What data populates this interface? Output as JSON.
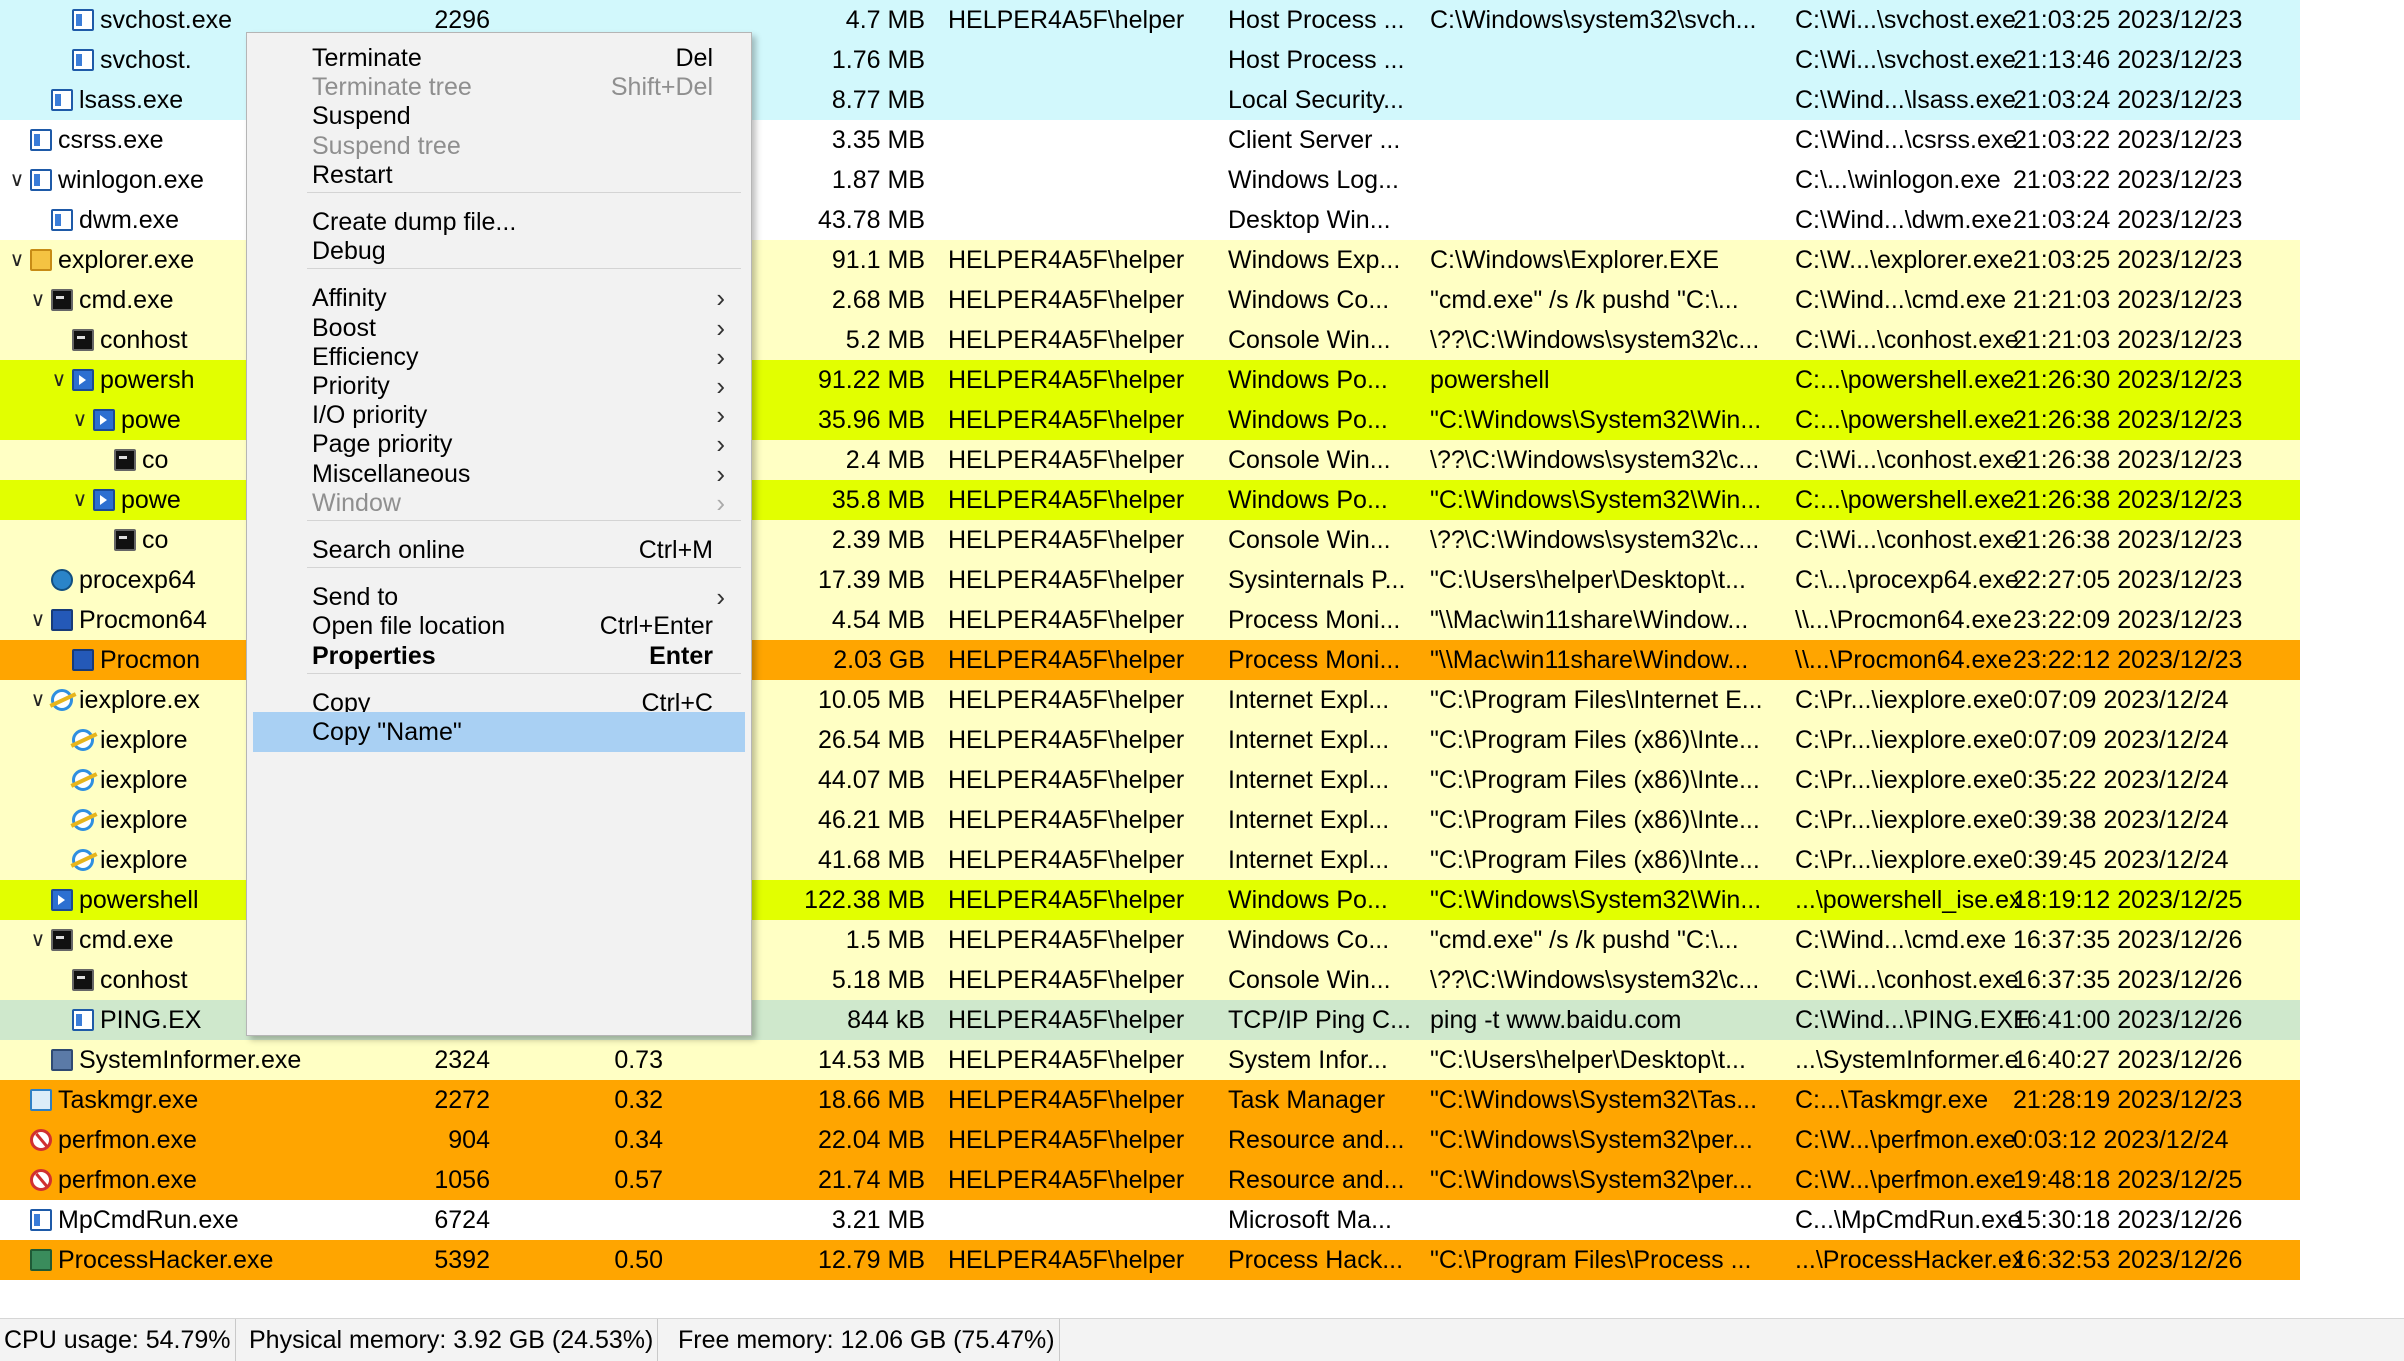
{
  "table": {
    "rows": [
      {
        "name": "svchost.exe",
        "pid": "2296",
        "cpu": "",
        "mem": "4.7 MB",
        "user": "HELPER4A5F\\helper",
        "desc": "Host Process ...",
        "cmd": "C:\\Windows\\system32\\svch...",
        "path": "C:\\Wi...\\svchost.exe",
        "time": "21:03:25 2023/12/23",
        "bg": "#d2f8fc",
        "depth": 3,
        "twisty": "",
        "icon": "service-icon"
      },
      {
        "name": "svchost.",
        "pid": "",
        "cpu": "",
        "mem": "1.76 MB",
        "user": "",
        "desc": "Host Process ...",
        "cmd": "",
        "path": "C:\\Wi...\\svchost.exe",
        "time": "21:13:46 2023/12/23",
        "bg": "#d2f8fc",
        "depth": 3,
        "twisty": "",
        "icon": "service-icon"
      },
      {
        "name": "lsass.exe",
        "pid": "",
        "cpu": "",
        "mem": "8.77 MB",
        "user": "",
        "desc": "Local Security...",
        "cmd": "",
        "path": "C:\\Wind...\\lsass.exe",
        "time": "21:03:24 2023/12/23",
        "bg": "#d2f8fc",
        "depth": 2,
        "twisty": "",
        "icon": "service-icon"
      },
      {
        "name": "csrss.exe",
        "pid": "",
        "cpu": "",
        "mem": "3.35 MB",
        "user": "",
        "desc": "Client Server ...",
        "cmd": "",
        "path": "C:\\Wind...\\csrss.exe",
        "time": "21:03:22 2023/12/23",
        "bg": "#ffffff",
        "depth": 1,
        "twisty": "",
        "icon": "window-icon"
      },
      {
        "name": "winlogon.exe",
        "pid": "",
        "cpu": "",
        "mem": "1.87 MB",
        "user": "",
        "desc": "Windows Log...",
        "cmd": "",
        "path": "C:\\...\\winlogon.exe",
        "time": "21:03:22 2023/12/23",
        "bg": "#ffffff",
        "depth": 1,
        "twisty": "v",
        "icon": "window-icon"
      },
      {
        "name": "dwm.exe",
        "pid": "",
        "cpu": "",
        "mem": "43.78 MB",
        "user": "",
        "desc": "Desktop Win...",
        "cmd": "",
        "path": "C:\\Wind...\\dwm.exe",
        "time": "21:03:24 2023/12/23",
        "bg": "#ffffff",
        "depth": 2,
        "twisty": "",
        "icon": "window-icon"
      },
      {
        "name": "explorer.exe",
        "pid": "",
        "cpu": "",
        "mem": "91.1 MB",
        "user": "HELPER4A5F\\helper",
        "desc": "Windows Exp...",
        "cmd": "C:\\Windows\\Explorer.EXE",
        "path": "C:\\W...\\explorer.exe",
        "time": "21:03:25 2023/12/23",
        "bg": "#ffffc4",
        "depth": 1,
        "twisty": "v",
        "icon": "explorer-icon"
      },
      {
        "name": "cmd.exe",
        "pid": "",
        "cpu": "",
        "mem": "2.68 MB",
        "user": "HELPER4A5F\\helper",
        "desc": "Windows Co...",
        "cmd": "\"cmd.exe\" /s /k pushd \"C:\\...",
        "path": "C:\\Wind...\\cmd.exe",
        "time": "21:21:03 2023/12/23",
        "bg": "#ffffc4",
        "depth": 2,
        "twisty": "v",
        "icon": "console-icon"
      },
      {
        "name": "conhost",
        "pid": "",
        "cpu": "",
        "mem": "5.2 MB",
        "user": "HELPER4A5F\\helper",
        "desc": "Console Win...",
        "cmd": "\\??\\C:\\Windows\\system32\\c...",
        "path": "C:\\Wi...\\conhost.exe",
        "time": "21:21:03 2023/12/23",
        "bg": "#ffffc4",
        "depth": 3,
        "twisty": "",
        "icon": "console-icon"
      },
      {
        "name": "powersh",
        "pid": "",
        "cpu": "",
        "mem": "91.22 MB",
        "user": "HELPER4A5F\\helper",
        "desc": "Windows Po...",
        "cmd": "powershell",
        "path": "C:...\\powershell.exe",
        "time": "21:26:30 2023/12/23",
        "bg": "#e2ff00",
        "depth": 3,
        "twisty": "v",
        "icon": "powershell-icon"
      },
      {
        "name": "powe",
        "pid": "",
        "cpu": "",
        "mem": "35.96 MB",
        "user": "HELPER4A5F\\helper",
        "desc": "Windows Po...",
        "cmd": "\"C:\\Windows\\System32\\Win...",
        "path": "C:...\\powershell.exe",
        "time": "21:26:38 2023/12/23",
        "bg": "#e2ff00",
        "depth": 4,
        "twisty": "v",
        "icon": "powershell-icon"
      },
      {
        "name": "co",
        "pid": "",
        "cpu": "",
        "mem": "2.4 MB",
        "user": "HELPER4A5F\\helper",
        "desc": "Console Win...",
        "cmd": "\\??\\C:\\Windows\\system32\\c...",
        "path": "C:\\Wi...\\conhost.exe",
        "time": "21:26:38 2023/12/23",
        "bg": "#ffffc4",
        "depth": 5,
        "twisty": "",
        "icon": "console-icon"
      },
      {
        "name": "powe",
        "pid": "",
        "cpu": "",
        "mem": "35.8 MB",
        "user": "HELPER4A5F\\helper",
        "desc": "Windows Po...",
        "cmd": "\"C:\\Windows\\System32\\Win...",
        "path": "C:...\\powershell.exe",
        "time": "21:26:38 2023/12/23",
        "bg": "#e2ff00",
        "depth": 4,
        "twisty": "v",
        "icon": "powershell-icon"
      },
      {
        "name": "co",
        "pid": "",
        "cpu": "",
        "mem": "2.39 MB",
        "user": "HELPER4A5F\\helper",
        "desc": "Console Win...",
        "cmd": "\\??\\C:\\Windows\\system32\\c...",
        "path": "C:\\Wi...\\conhost.exe",
        "time": "21:26:38 2023/12/23",
        "bg": "#ffffc4",
        "depth": 5,
        "twisty": "",
        "icon": "console-icon"
      },
      {
        "name": "procexp64",
        "pid": "",
        "cpu": "",
        "mem": "17.39 MB",
        "user": "HELPER4A5F\\helper",
        "desc": "Sysinternals P...",
        "cmd": "\"C:\\Users\\helper\\Desktop\\t...",
        "path": "C:\\...\\procexp64.exe",
        "time": "22:27:05 2023/12/23",
        "bg": "#ffffc4",
        "depth": 2,
        "twisty": "",
        "icon": "process-explorer-icon"
      },
      {
        "name": "Procmon64",
        "pid": "",
        "cpu": "",
        "mem": "4.54 MB",
        "user": "HELPER4A5F\\helper",
        "desc": "Process Moni...",
        "cmd": "\"\\\\Mac\\win11share\\Window...",
        "path": "\\\\...\\Procmon64.exe",
        "time": "23:22:09 2023/12/23",
        "bg": "#ffffc4",
        "depth": 2,
        "twisty": "v",
        "icon": "process-monitor-icon"
      },
      {
        "name": "Procmon",
        "pid": "",
        "cpu": "",
        "mem": "2.03 GB",
        "user": "HELPER4A5F\\helper",
        "desc": "Process Moni...",
        "cmd": "\"\\\\Mac\\win11share\\Window...",
        "path": "\\\\...\\Procmon64.exe",
        "time": "23:22:12 2023/12/23",
        "bg": "#ffa500",
        "depth": 3,
        "twisty": "",
        "icon": "process-monitor-icon"
      },
      {
        "name": "iexplore.ex",
        "pid": "",
        "cpu": "",
        "mem": "10.05 MB",
        "user": "HELPER4A5F\\helper",
        "desc": "Internet Expl...",
        "cmd": "\"C:\\Program Files\\Internet E...",
        "path": "C:\\Pr...\\iexplore.exe",
        "time": "0:07:09 2023/12/24",
        "bg": "#ffffc4",
        "depth": 2,
        "twisty": "v",
        "icon": "internet-explorer-icon"
      },
      {
        "name": "iexplore",
        "pid": "",
        "cpu": "",
        "mem": "26.54 MB",
        "user": "HELPER4A5F\\helper",
        "desc": "Internet Expl...",
        "cmd": "\"C:\\Program Files (x86)\\Inte...",
        "path": "C:\\Pr...\\iexplore.exe",
        "time": "0:07:09 2023/12/24",
        "bg": "#ffffc4",
        "depth": 3,
        "twisty": "",
        "icon": "internet-explorer-icon"
      },
      {
        "name": "iexplore",
        "pid": "",
        "cpu": "",
        "mem": "44.07 MB",
        "user": "HELPER4A5F\\helper",
        "desc": "Internet Expl...",
        "cmd": "\"C:\\Program Files (x86)\\Inte...",
        "path": "C:\\Pr...\\iexplore.exe",
        "time": "0:35:22 2023/12/24",
        "bg": "#ffffc4",
        "depth": 3,
        "twisty": "",
        "icon": "internet-explorer-icon"
      },
      {
        "name": "iexplore",
        "pid": "",
        "cpu": "",
        "mem": "46.21 MB",
        "user": "HELPER4A5F\\helper",
        "desc": "Internet Expl...",
        "cmd": "\"C:\\Program Files (x86)\\Inte...",
        "path": "C:\\Pr...\\iexplore.exe",
        "time": "0:39:38 2023/12/24",
        "bg": "#ffffc4",
        "depth": 3,
        "twisty": "",
        "icon": "internet-explorer-icon"
      },
      {
        "name": "iexplore",
        "pid": "",
        "cpu": "",
        "mem": "41.68 MB",
        "user": "HELPER4A5F\\helper",
        "desc": "Internet Expl...",
        "cmd": "\"C:\\Program Files (x86)\\Inte...",
        "path": "C:\\Pr...\\iexplore.exe",
        "time": "0:39:45 2023/12/24",
        "bg": "#ffffc4",
        "depth": 3,
        "twisty": "",
        "icon": "internet-explorer-icon"
      },
      {
        "name": "powershell",
        "pid": "",
        "cpu": "",
        "mem": "122.38 MB",
        "user": "HELPER4A5F\\helper",
        "desc": "Windows Po...",
        "cmd": "\"C:\\Windows\\System32\\Win...",
        "path": "...\\powershell_ise.ex",
        "time": "18:19:12 2023/12/25",
        "bg": "#e2ff00",
        "depth": 2,
        "twisty": "",
        "icon": "powershell-ise-icon"
      },
      {
        "name": "cmd.exe",
        "pid": "",
        "cpu": "",
        "mem": "1.5 MB",
        "user": "HELPER4A5F\\helper",
        "desc": "Windows Co...",
        "cmd": "\"cmd.exe\" /s /k pushd \"C:\\...",
        "path": "C:\\Wind...\\cmd.exe",
        "time": "16:37:35 2023/12/26",
        "bg": "#ffffc4",
        "depth": 2,
        "twisty": "v",
        "icon": "console-icon"
      },
      {
        "name": "conhost",
        "pid": "",
        "cpu": "",
        "mem": "5.18 MB",
        "user": "HELPER4A5F\\helper",
        "desc": "Console Win...",
        "cmd": "\\??\\C:\\Windows\\system32\\c...",
        "path": "C:\\Wi...\\conhost.exe",
        "time": "16:37:35 2023/12/26",
        "bg": "#ffffc4",
        "depth": 3,
        "twisty": "",
        "icon": "console-icon"
      },
      {
        "name": "PING.EX",
        "pid": "",
        "cpu": "",
        "mem": "844 kB",
        "user": "HELPER4A5F\\helper",
        "desc": "TCP/IP Ping C...",
        "cmd": "ping  -t www.baidu.com",
        "path": "C:\\Wind...\\PING.EXE",
        "time": "16:41:00 2023/12/26",
        "bg": "#cfe8cc",
        "depth": 3,
        "twisty": "",
        "icon": "window-icon"
      },
      {
        "name": "SystemInformer.exe",
        "pid": "2324",
        "cpu": "0.73",
        "mem": "14.53 MB",
        "user": "HELPER4A5F\\helper",
        "desc": "System Infor...",
        "cmd": "\"C:\\Users\\helper\\Desktop\\t...",
        "path": "...\\SystemInformer.e",
        "time": "16:40:27 2023/12/26",
        "bg": "#ffffc4",
        "depth": 2,
        "twisty": "",
        "icon": "system-informer-icon"
      },
      {
        "name": "Taskmgr.exe",
        "pid": "2272",
        "cpu": "0.32",
        "mem": "18.66 MB",
        "user": "HELPER4A5F\\helper",
        "desc": "Task Manager",
        "cmd": "\"C:\\Windows\\System32\\Tas...",
        "path": "C:...\\Taskmgr.exe",
        "time": "21:28:19 2023/12/23",
        "bg": "#ffa500",
        "depth": 1,
        "twisty": "",
        "icon": "task-manager-icon"
      },
      {
        "name": "perfmon.exe",
        "pid": "904",
        "cpu": "0.34",
        "mem": "22.04 MB",
        "user": "HELPER4A5F\\helper",
        "desc": "Resource and...",
        "cmd": "\"C:\\Windows\\System32\\per...",
        "path": "C:\\W...\\perfmon.exe",
        "time": "0:03:12 2023/12/24",
        "bg": "#ffa500",
        "depth": 1,
        "twisty": "",
        "icon": "perfmon-icon"
      },
      {
        "name": "perfmon.exe",
        "pid": "1056",
        "cpu": "0.57",
        "mem": "21.74 MB",
        "user": "HELPER4A5F\\helper",
        "desc": "Resource and...",
        "cmd": "\"C:\\Windows\\System32\\per...",
        "path": "C:\\W...\\perfmon.exe",
        "time": "19:48:18 2023/12/25",
        "bg": "#ffa500",
        "depth": 1,
        "twisty": "",
        "icon": "perfmon-icon"
      },
      {
        "name": "MpCmdRun.exe",
        "pid": "6724",
        "cpu": "",
        "mem": "3.21 MB",
        "user": "",
        "desc": "Microsoft Ma...",
        "cmd": "",
        "path": "C...\\MpCmdRun.exe",
        "time": "15:30:18 2023/12/26",
        "bg": "#ffffff",
        "depth": 1,
        "twisty": "",
        "icon": "window-icon"
      },
      {
        "name": "ProcessHacker.exe",
        "pid": "5392",
        "cpu": "0.50",
        "mem": "12.79 MB",
        "user": "HELPER4A5F\\helper",
        "desc": "Process Hack...",
        "cmd": "\"C:\\Program Files\\Process ...",
        "path": "...\\ProcessHacker.ex",
        "time": "16:32:53 2023/12/26",
        "bg": "#ffa500",
        "depth": 1,
        "twisty": "",
        "icon": "process-hacker-icon"
      }
    ]
  },
  "context_menu": {
    "items": [
      {
        "label": "Terminate",
        "shortcut": "Del",
        "type": "item"
      },
      {
        "label": "Terminate tree",
        "shortcut": "Shift+Del",
        "type": "item",
        "disabled": true
      },
      {
        "label": "Suspend",
        "shortcut": "",
        "type": "item"
      },
      {
        "label": "Suspend tree",
        "shortcut": "",
        "type": "item",
        "disabled": true
      },
      {
        "label": "Restart",
        "shortcut": "",
        "type": "item"
      },
      {
        "type": "separator"
      },
      {
        "label": "Create dump file...",
        "shortcut": "",
        "type": "item"
      },
      {
        "label": "Debug",
        "shortcut": "",
        "type": "item"
      },
      {
        "type": "separator"
      },
      {
        "label": "Affinity",
        "shortcut": "",
        "type": "submenu"
      },
      {
        "label": "Boost",
        "shortcut": "",
        "type": "submenu"
      },
      {
        "label": "Efficiency",
        "shortcut": "",
        "type": "submenu"
      },
      {
        "label": "Priority",
        "shortcut": "",
        "type": "submenu"
      },
      {
        "label": "I/O priority",
        "shortcut": "",
        "type": "submenu"
      },
      {
        "label": "Page priority",
        "shortcut": "",
        "type": "submenu"
      },
      {
        "label": "Miscellaneous",
        "shortcut": "",
        "type": "submenu"
      },
      {
        "label": "Window",
        "shortcut": "",
        "type": "submenu",
        "disabled": true
      },
      {
        "type": "separator"
      },
      {
        "label": "Search online",
        "shortcut": "Ctrl+M",
        "type": "item"
      },
      {
        "type": "separator"
      },
      {
        "label": "Send to",
        "shortcut": "",
        "type": "submenu"
      },
      {
        "label": "Open file location",
        "shortcut": "Ctrl+Enter",
        "type": "item"
      },
      {
        "label": "Properties",
        "shortcut": "Enter",
        "type": "item",
        "bold": true
      },
      {
        "type": "separator"
      },
      {
        "label": "Copy",
        "shortcut": "Ctrl+C",
        "type": "item"
      },
      {
        "label": "Copy \"Name\"",
        "shortcut": "",
        "type": "item",
        "highlighted": true
      }
    ]
  },
  "status_bar": {
    "cpu": "CPU usage: 54.79%",
    "physical": "Physical memory: 3.92 GB (24.53%)",
    "free": "Free memory: 12.06 GB (75.47%)"
  }
}
